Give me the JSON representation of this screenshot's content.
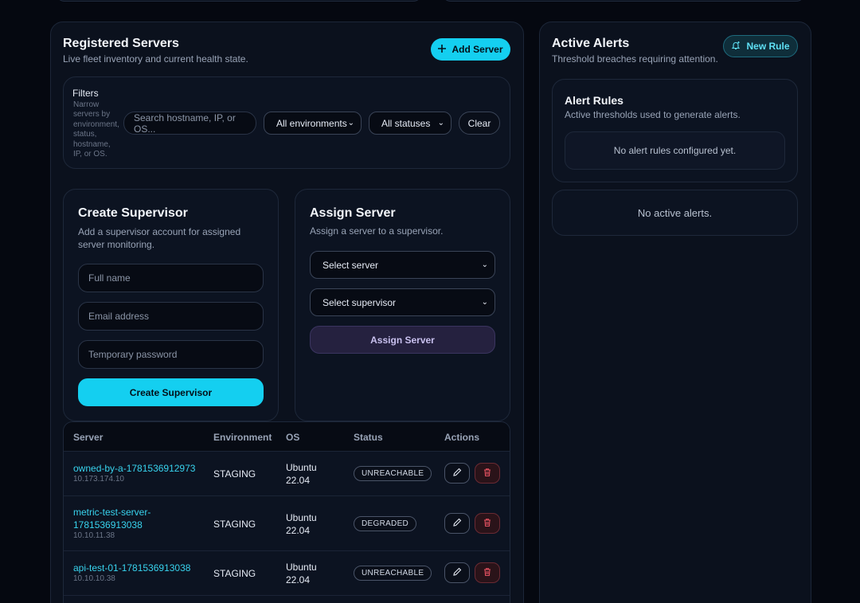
{
  "servers_panel": {
    "title": "Registered Servers",
    "subtitle": "Live fleet inventory and current health state.",
    "add_button": "Add Server"
  },
  "filters": {
    "title": "Filters",
    "description": "Narrow servers by environment, status, hostname, IP, or OS.",
    "search_placeholder": "Search hostname, IP, or OS...",
    "environment_selected": "All environments",
    "status_selected": "All statuses",
    "clear_label": "Clear"
  },
  "create_supervisor": {
    "title": "Create Supervisor",
    "subtitle": "Add a supervisor account for assigned server monitoring.",
    "full_name_placeholder": "Full name",
    "email_placeholder": "Email address",
    "password_placeholder": "Temporary password",
    "submit_label": "Create Supervisor"
  },
  "assign_server": {
    "title": "Assign Server",
    "subtitle": "Assign a server to a supervisor.",
    "server_select": "Select server",
    "supervisor_select": "Select supervisor",
    "submit_label": "Assign Server"
  },
  "table": {
    "columns": [
      "Server",
      "Environment",
      "OS",
      "Status",
      "Actions"
    ],
    "rows": [
      {
        "host": "owned-by-a-1781536912973",
        "ip": "10.173.174.10",
        "env": "STAGING",
        "os": [
          "Ubuntu",
          "22.04"
        ],
        "status": "UNREACHABLE"
      },
      {
        "host": [
          "metric-test-server-",
          "1781536913038"
        ],
        "ip": "10.10.11.38",
        "env": "STAGING",
        "os": [
          "Ubuntu",
          "22.04"
        ],
        "status": "DEGRADED"
      },
      {
        "host": "api-test-01-1781536913038",
        "ip": "10.10.10.38",
        "env": "STAGING",
        "os": [
          "Ubuntu",
          "22.04"
        ],
        "status": "UNREACHABLE"
      }
    ]
  },
  "alerts_panel": {
    "title": "Active Alerts",
    "subtitle": "Threshold breaches requiring attention.",
    "new_rule_button": "New Rule",
    "rules_title": "Alert Rules",
    "rules_subtitle": "Active thresholds used to generate alerts.",
    "rules_empty": "No alert rules configured yet.",
    "alerts_empty": "No active alerts."
  },
  "colors": {
    "accent": "#14cff0",
    "background": "#050810",
    "panel": "#0b111d",
    "danger": "#e0505f"
  },
  "icons": {
    "add": "plus-icon",
    "new_rule": "bell-plus-icon",
    "edit": "pencil-icon",
    "delete": "trash-icon",
    "select": "chevron-down-icon"
  }
}
